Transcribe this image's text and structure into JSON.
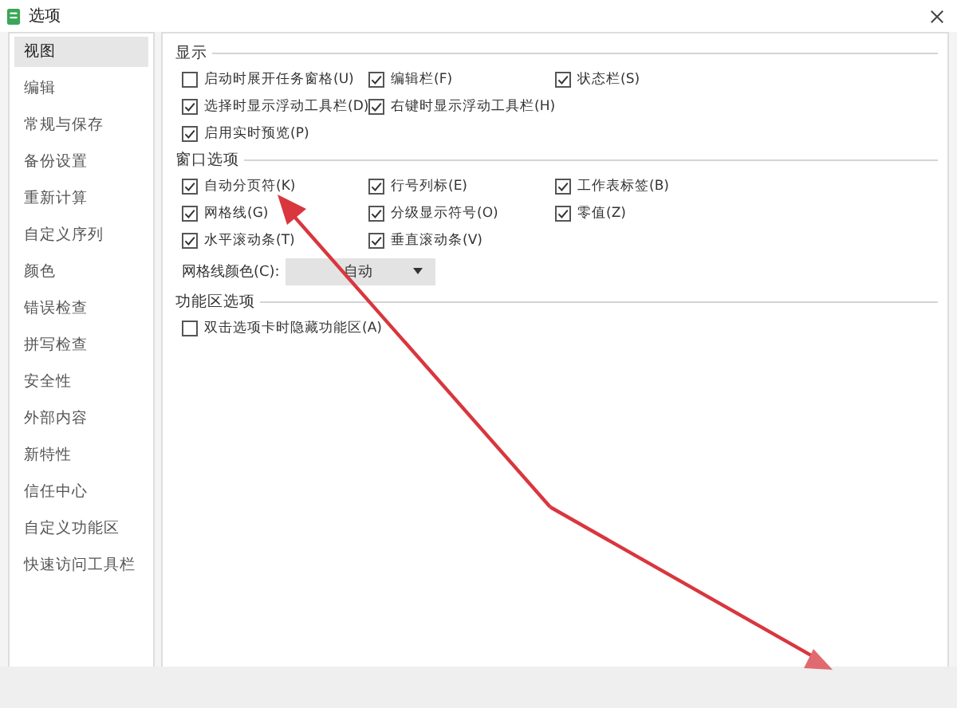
{
  "window": {
    "title": "选项"
  },
  "sidebar": {
    "items": [
      {
        "label": "视图",
        "selected": true
      },
      {
        "label": "编辑",
        "selected": false
      },
      {
        "label": "常规与保存",
        "selected": false
      },
      {
        "label": "备份设置",
        "selected": false
      },
      {
        "label": "重新计算",
        "selected": false
      },
      {
        "label": "自定义序列",
        "selected": false
      },
      {
        "label": "颜色",
        "selected": false
      },
      {
        "label": "错误检查",
        "selected": false
      },
      {
        "label": "拼写检查",
        "selected": false
      },
      {
        "label": "安全性",
        "selected": false
      },
      {
        "label": "外部内容",
        "selected": false
      },
      {
        "label": "新特性",
        "selected": false
      },
      {
        "label": "信任中心",
        "selected": false
      },
      {
        "label": "自定义功能区",
        "selected": false
      },
      {
        "label": "快速访问工具栏",
        "selected": false
      }
    ]
  },
  "sections": [
    {
      "title": "显示",
      "rows": [
        [
          {
            "label": "启动时展开任务窗格(U)",
            "checked": false
          },
          {
            "label": "编辑栏(F)",
            "checked": true
          },
          {
            "label": "状态栏(S)",
            "checked": true
          }
        ],
        [
          {
            "label": "选择时显示浮动工具栏(D)",
            "checked": true
          },
          {
            "label": "右键时显示浮动工具栏(H)",
            "checked": true
          }
        ],
        [
          {
            "label": "启用实时预览(P)",
            "checked": true
          }
        ]
      ]
    },
    {
      "title": "窗口选项",
      "rows": [
        [
          {
            "label": "自动分页符(K)",
            "checked": true
          },
          {
            "label": "行号列标(E)",
            "checked": true
          },
          {
            "label": "工作表标签(B)",
            "checked": true
          }
        ],
        [
          {
            "label": "网格线(G)",
            "checked": true
          },
          {
            "label": "分级显示符号(O)",
            "checked": true
          },
          {
            "label": "零值(Z)",
            "checked": true
          }
        ],
        [
          {
            "label": "水平滚动条(T)",
            "checked": true
          },
          {
            "label": "垂直滚动条(V)",
            "checked": true
          }
        ]
      ],
      "dropdown": {
        "label": "网格线颜色(C):",
        "value": "自动"
      }
    },
    {
      "title": "功能区选项",
      "rows": [
        [
          {
            "label": "双击选项卡时隐藏功能区(A)",
            "checked": false
          }
        ]
      ]
    }
  ]
}
